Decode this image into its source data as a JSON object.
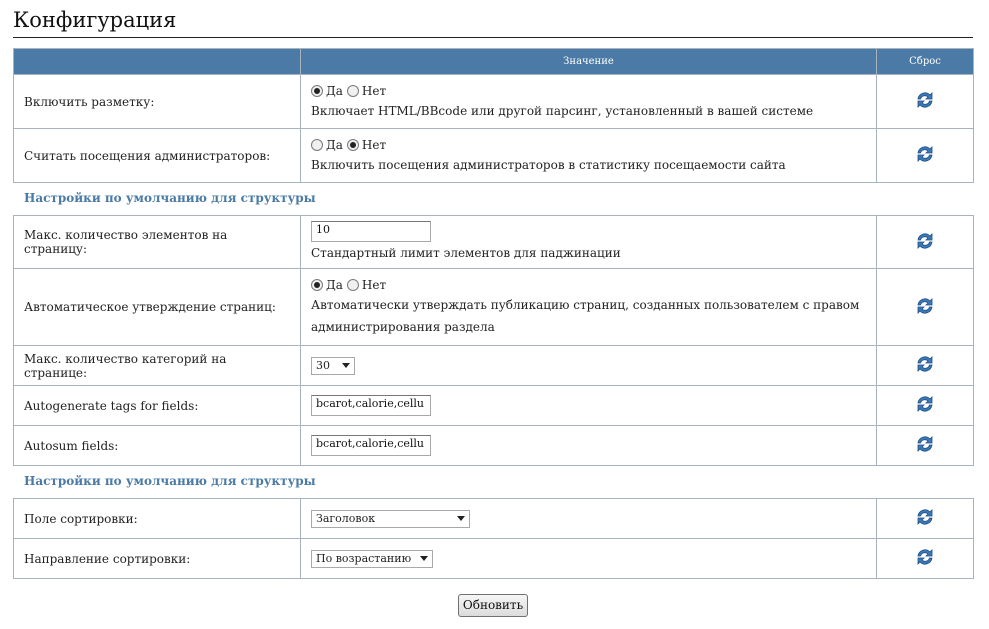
{
  "page": {
    "title": "Конфигурация"
  },
  "header": {
    "value_col": "Значение",
    "reset_col": "Сброс"
  },
  "rows_top": [
    {
      "label": "Включить разметку:",
      "radio_yes": "Да",
      "radio_no": "Нет",
      "selected": "yes",
      "desc": "Включает HTML/BBcode или другой парсинг, установленный в вашей системе"
    },
    {
      "label": "Считать посещения администраторов:",
      "radio_yes": "Да",
      "radio_no": "Нет",
      "selected": "no",
      "desc": "Включить посещения администраторов в статистику посещаемости сайта"
    }
  ],
  "section1": {
    "title": "Настройки по умолчанию для структуры"
  },
  "rows_mid": {
    "items_per_page": {
      "label": "Макс. количество элементов на страницу:",
      "value": "10",
      "desc": "Стандартный лимит элементов для паджинации"
    },
    "auto_approve": {
      "label": "Автоматическое утверждение страниц:",
      "radio_yes": "Да",
      "radio_no": "Нет",
      "selected": "yes",
      "desc_line1": "Автоматически утверждать публикацию страниц, созданных пользователем с правом",
      "desc_line2": "администрирования раздела"
    },
    "categories_per_page": {
      "label": "Макс. количество категорий на странице:",
      "value": "30"
    },
    "autogen_tags": {
      "label": "Autogenerate tags for fields:",
      "value": "bcarot,calorie,cellu"
    },
    "autosum": {
      "label": "Autosum fields:",
      "value": "bcarot,calorie,cellu"
    }
  },
  "section2": {
    "title": "Настройки по умолчанию для структуры"
  },
  "rows_bottom": {
    "sort_field": {
      "label": "Поле сортировки:",
      "value": "Заголовок"
    },
    "sort_dir": {
      "label": "Направление сортировки:",
      "value": "По возрастанию"
    }
  },
  "actions": {
    "update": "Обновить"
  },
  "icons": {
    "reset": "refresh-icon"
  },
  "colors": {
    "header_bg": "#4a7aa5",
    "section_text": "#4a7aa5",
    "border": "#a7b4c0"
  }
}
